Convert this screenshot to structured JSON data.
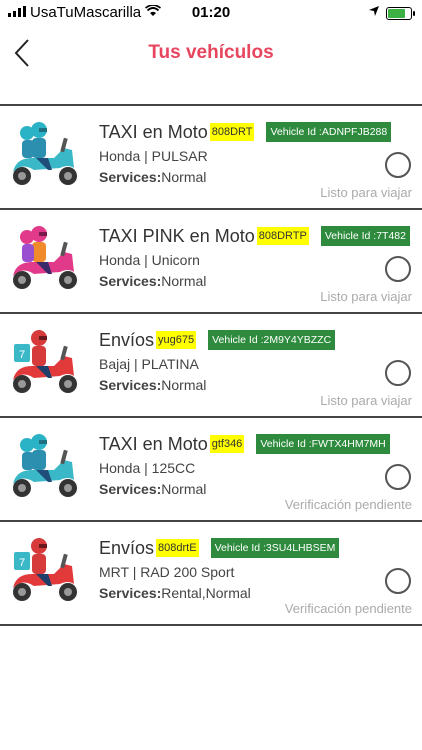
{
  "status_bar": {
    "carrier": "UsaTuMascarilla",
    "time": "01:20"
  },
  "header": {
    "title": "Tus vehículos",
    "back_icon": "chevron-left-icon"
  },
  "vehicles": [
    {
      "type": "TAXI en Moto",
      "plate": "808DRT",
      "vehicle_id": "Vehicle Id :ADNPFJB288",
      "model": "Honda | PULSAR",
      "services_label": "Services:",
      "services": "Normal",
      "status": "Listo para viajar",
      "icon": "taxi-moto-icon"
    },
    {
      "type": "TAXI PINK en Moto",
      "plate": "808DRTP",
      "vehicle_id": "Vehicle Id :7T482",
      "model": "Honda | Unicorn",
      "services_label": "Services:",
      "services": "Normal",
      "status": "Listo para viajar",
      "icon": "pink-taxi-moto-icon"
    },
    {
      "type": "Envíos",
      "plate": "yug675",
      "vehicle_id": "Vehicle Id :2M9Y4YBZZC",
      "model": "Bajaj | PLATINA",
      "services_label": "Services:",
      "services": "Normal",
      "status": "Listo para viajar",
      "icon": "delivery-moto-icon"
    },
    {
      "type": "TAXI en Moto",
      "plate": "gtf346",
      "vehicle_id": "Vehicle Id :FWTX4HM7MH",
      "model": "Honda | 125CC",
      "services_label": "Services:",
      "services": "Normal",
      "status": "Verificación pendiente",
      "icon": "taxi-moto-icon"
    },
    {
      "type": "Envíos",
      "plate": "808drtE",
      "vehicle_id": "Vehicle Id :3SU4LHBSEM",
      "model": "MRT | RAD 200 Sport",
      "services_label": "Services:",
      "services": "Rental,Normal",
      "status": "Verificación pendiente",
      "icon": "delivery-moto-icon"
    }
  ],
  "colors": {
    "title": "#e8455e",
    "plate_bg": "#ffff00",
    "vehicle_id_bg": "#2e8b3d",
    "status_text": "#aaaaaa"
  }
}
